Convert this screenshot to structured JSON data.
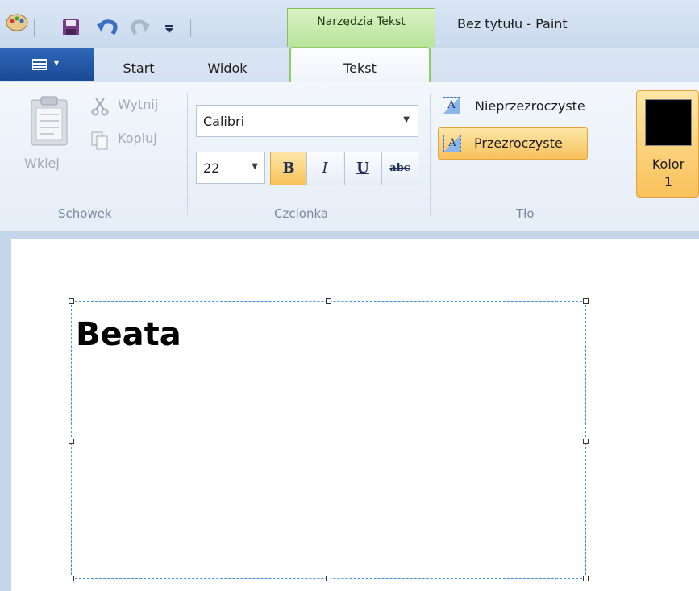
{
  "window": {
    "title": "Bez tytułu - Paint",
    "context_tab": "Narzędzia Tekst"
  },
  "tabs": {
    "start": "Start",
    "view": "Widok",
    "text": "Tekst"
  },
  "clipboard": {
    "paste": "Wklej",
    "cut": "Wytnij",
    "copy": "Kopiuj",
    "group": "Schowek"
  },
  "font": {
    "name": "Calibri",
    "size": "22",
    "bold": "B",
    "italic": "I",
    "underline": "U",
    "strike": "abc",
    "group": "Czcionka"
  },
  "background": {
    "opaque": "Nieprzezroczyste",
    "transparent": "Przezroczyste",
    "icon_glyph": "A",
    "group": "Tło"
  },
  "color1": {
    "label_line1": "Kolor",
    "label_line2": "1",
    "value": "#000000"
  },
  "canvas": {
    "text": "Beata"
  },
  "colors": {
    "accent_selected": "#f9c15a",
    "context_green": "#b8e49a",
    "app_menu_blue": "#1a4a96",
    "selection_border": "#3d8ee6"
  }
}
